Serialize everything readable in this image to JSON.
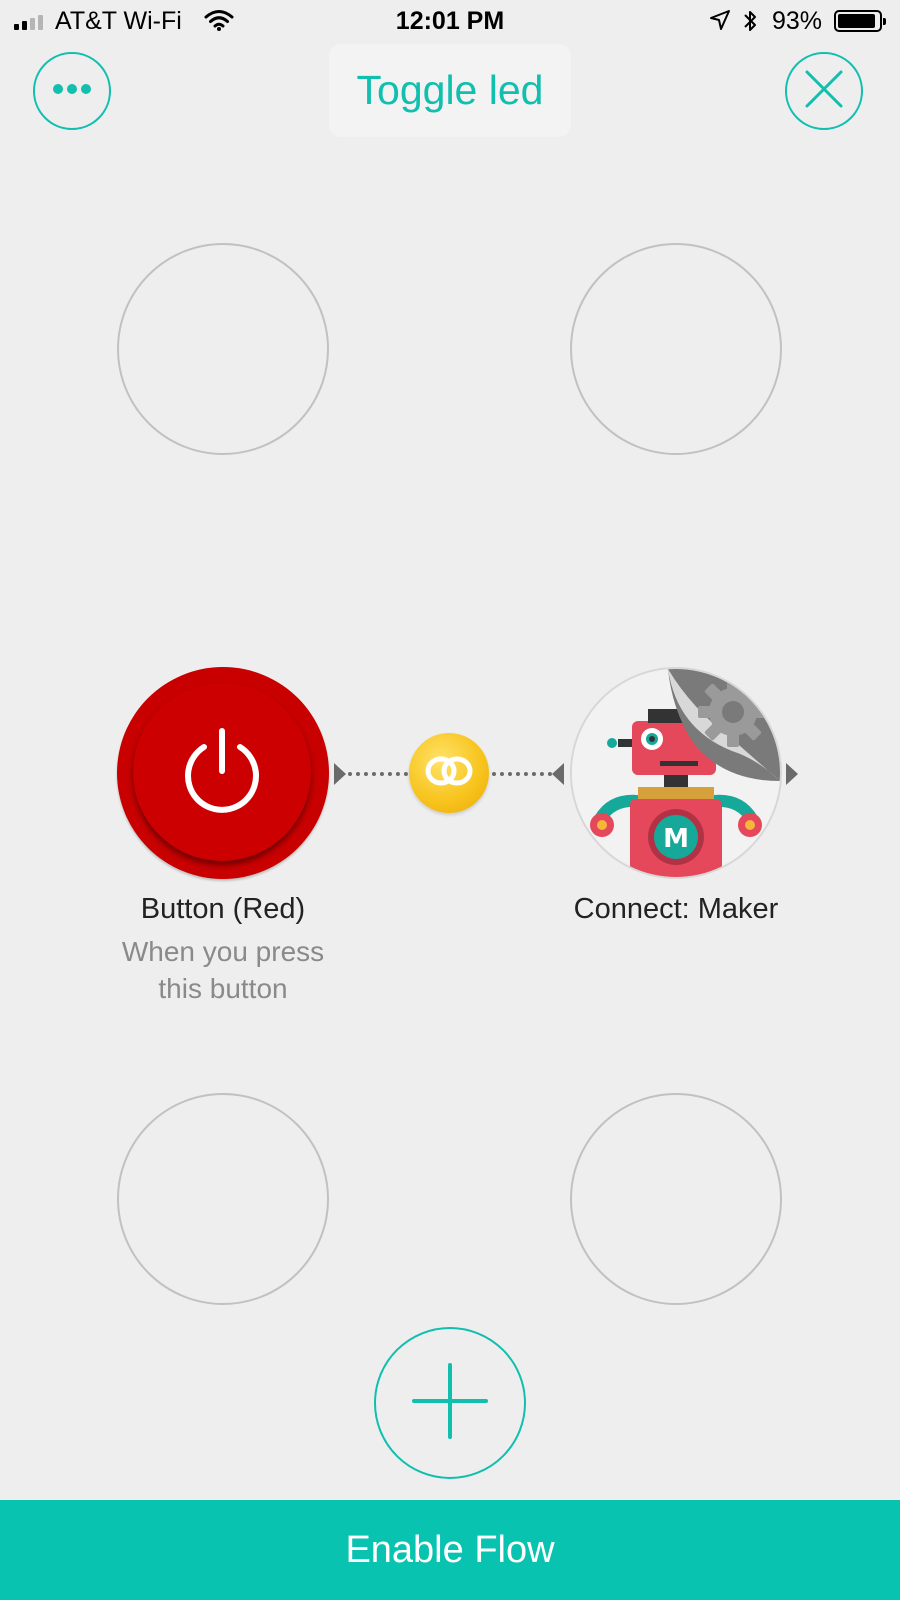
{
  "status_bar": {
    "carrier": "AT&T Wi-Fi",
    "time": "12:01 PM",
    "battery_percent": "93%",
    "battery_level": 0.93
  },
  "header": {
    "title": "Toggle led",
    "menu_icon": "more-horizontal-icon",
    "close_icon": "close-icon"
  },
  "flow": {
    "trigger": {
      "title": "Button (Red)",
      "subtitle_line1": "When you press",
      "subtitle_line2": "this button",
      "icon": "power-icon"
    },
    "link_icon": "chain-link-icon",
    "action": {
      "title": "Connect: Maker",
      "icon": "maker-robot-icon",
      "settings_icon": "gear-icon"
    }
  },
  "add_icon": "plus-icon",
  "footer": {
    "enable_label": "Enable Flow"
  },
  "colors": {
    "accent": "#10bfae",
    "footer": "#09c3b1",
    "trigger_red": "#cc0000",
    "link_gold": "#f7c21a",
    "background": "#eeeeee"
  }
}
